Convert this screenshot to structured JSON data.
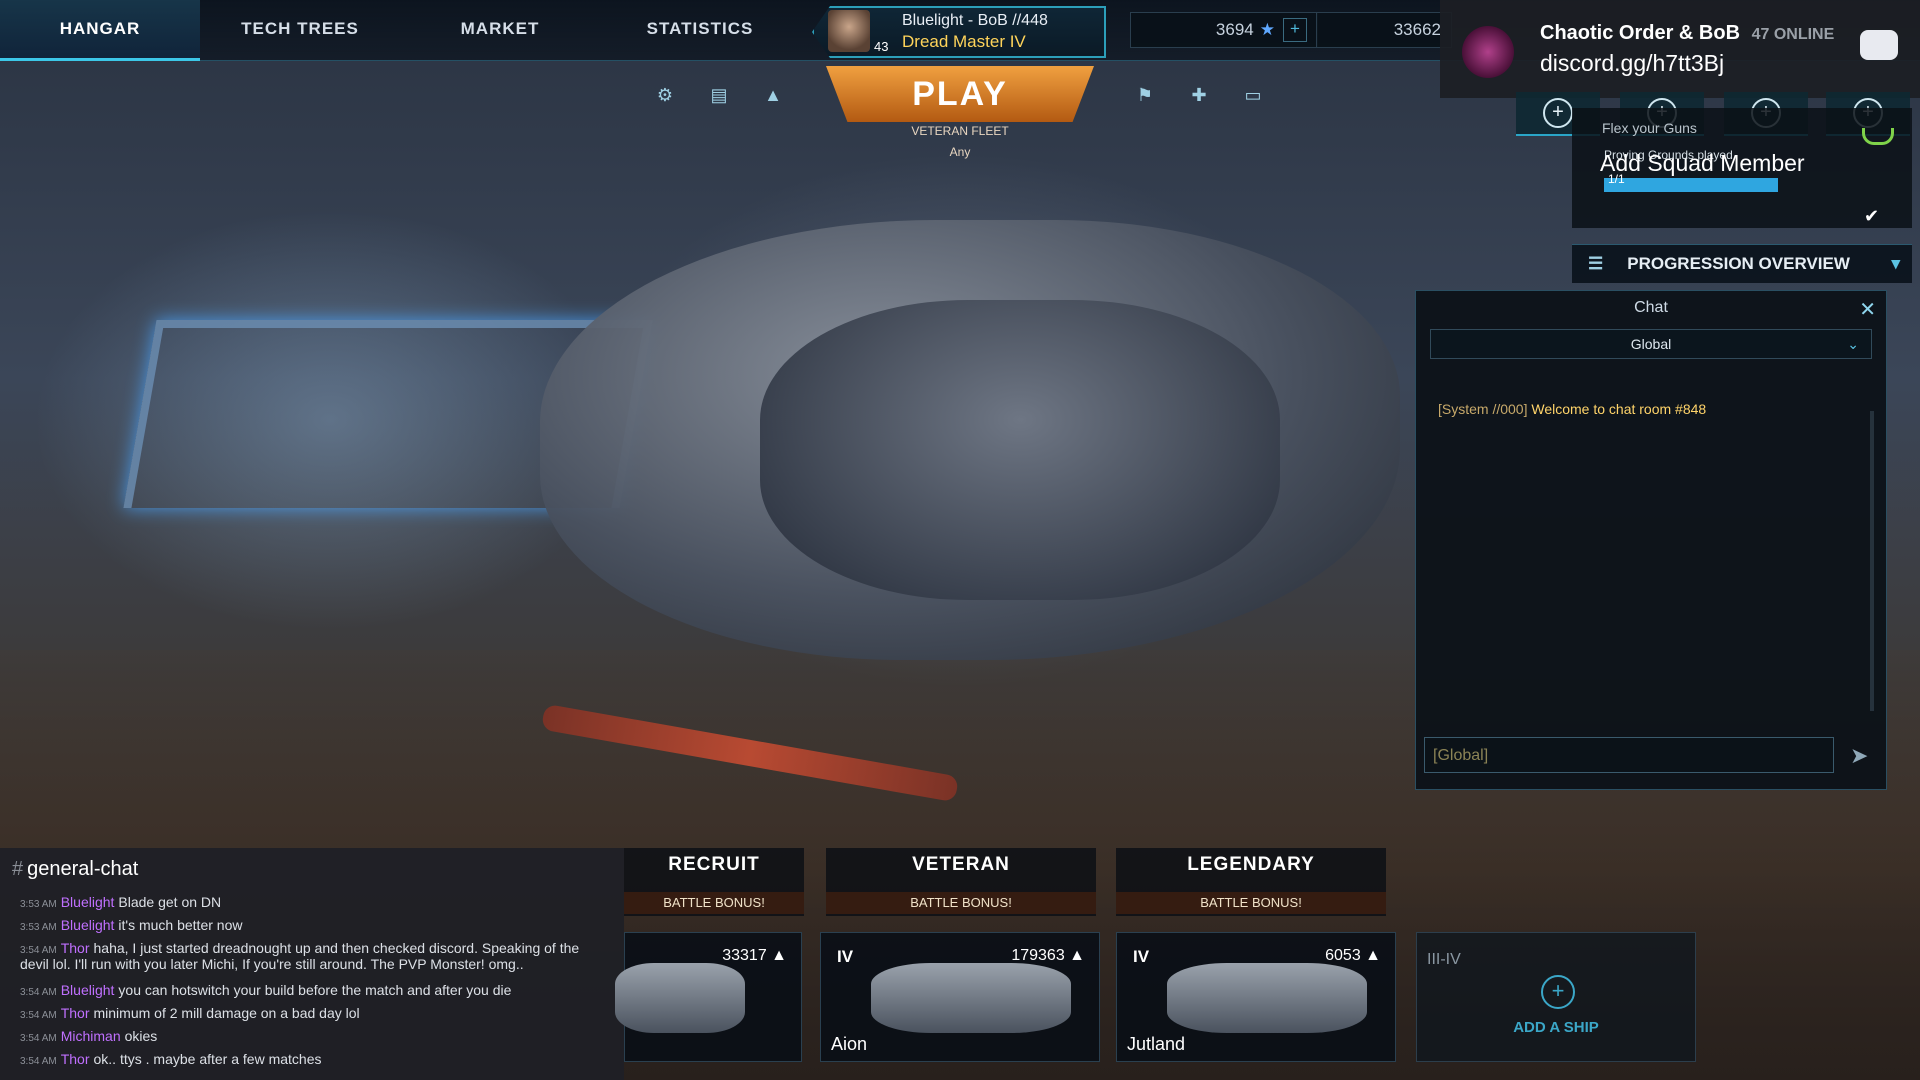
{
  "nav": {
    "tabs": [
      {
        "label": "HANGAR",
        "active": true
      },
      {
        "label": "TECH TREES"
      },
      {
        "label": "MARKET"
      },
      {
        "label": "STATISTICS"
      }
    ]
  },
  "player": {
    "name": "Bluelight - BoB //448",
    "title": "Dread Master IV",
    "level": "43"
  },
  "currency": {
    "credits": "3694",
    "gold": "33662"
  },
  "discord": {
    "server": "Chaotic Order & BoB",
    "online": "47 ONLINE",
    "invite": "discord.gg/h7tt3Bj"
  },
  "play": {
    "label": "PLAY",
    "fleet": "VETERAN FLEET",
    "filter": "Any"
  },
  "quest": {
    "title": "Flex your Guns",
    "line": "Proving Grounds played",
    "count": "1/1",
    "progress": 1.0
  },
  "squad": {
    "add_label": "Add Squad Member"
  },
  "progression": {
    "label": "PROGRESSION OVERVIEW"
  },
  "chat": {
    "title": "Chat",
    "channel": "Global",
    "system_prefix": "[System //000]",
    "welcome": "Welcome to chat room #848",
    "placeholder": "[Global]"
  },
  "general_chat": {
    "channel": "general-chat",
    "messages": [
      {
        "time": "3:53 AM",
        "user": "Bluelight",
        "text": "Blade get on DN"
      },
      {
        "time": "3:53 AM",
        "user": "Bluelight",
        "text": "it's much better now"
      },
      {
        "time": "3:54 AM",
        "user": "Thor",
        "text": "haha, I just started dreadnought up and then checked discord. Speaking of the devil lol. I'll run with you later Michi, If you're still around. The PVP Monster! omg.."
      },
      {
        "time": "3:54 AM",
        "user": "Bluelight",
        "text": "you can hotswitch your build before the match and after you die"
      },
      {
        "time": "3:54 AM",
        "user": "Thor",
        "text": "minimum of 2 mill damage on a bad day lol"
      },
      {
        "time": "3:54 AM",
        "user": "Michiman",
        "text": "okies"
      },
      {
        "time": "3:54 AM",
        "user": "Thor",
        "text": "ok.. ttys . maybe after a few matches"
      }
    ]
  },
  "tiers": [
    {
      "name": "RECRUIT",
      "bonus": "BATTLE BONUS!"
    },
    {
      "name": "VETERAN",
      "bonus": "BATTLE BONUS!"
    },
    {
      "name": "LEGENDARY",
      "bonus": "BATTLE BONUS!"
    }
  ],
  "ships": [
    {
      "tier": "",
      "xp": "33317",
      "name": ""
    },
    {
      "tier": "IV",
      "xp": "179363",
      "name": "Aion"
    },
    {
      "tier": "IV",
      "xp": "6053",
      "name": "Jutland"
    }
  ],
  "add_ship": {
    "tier": "III-IV",
    "label": "ADD A SHIP"
  },
  "colors": {
    "accent": "#3cc7e8",
    "play": "#e08a2c",
    "gold": "#ffd45a"
  }
}
